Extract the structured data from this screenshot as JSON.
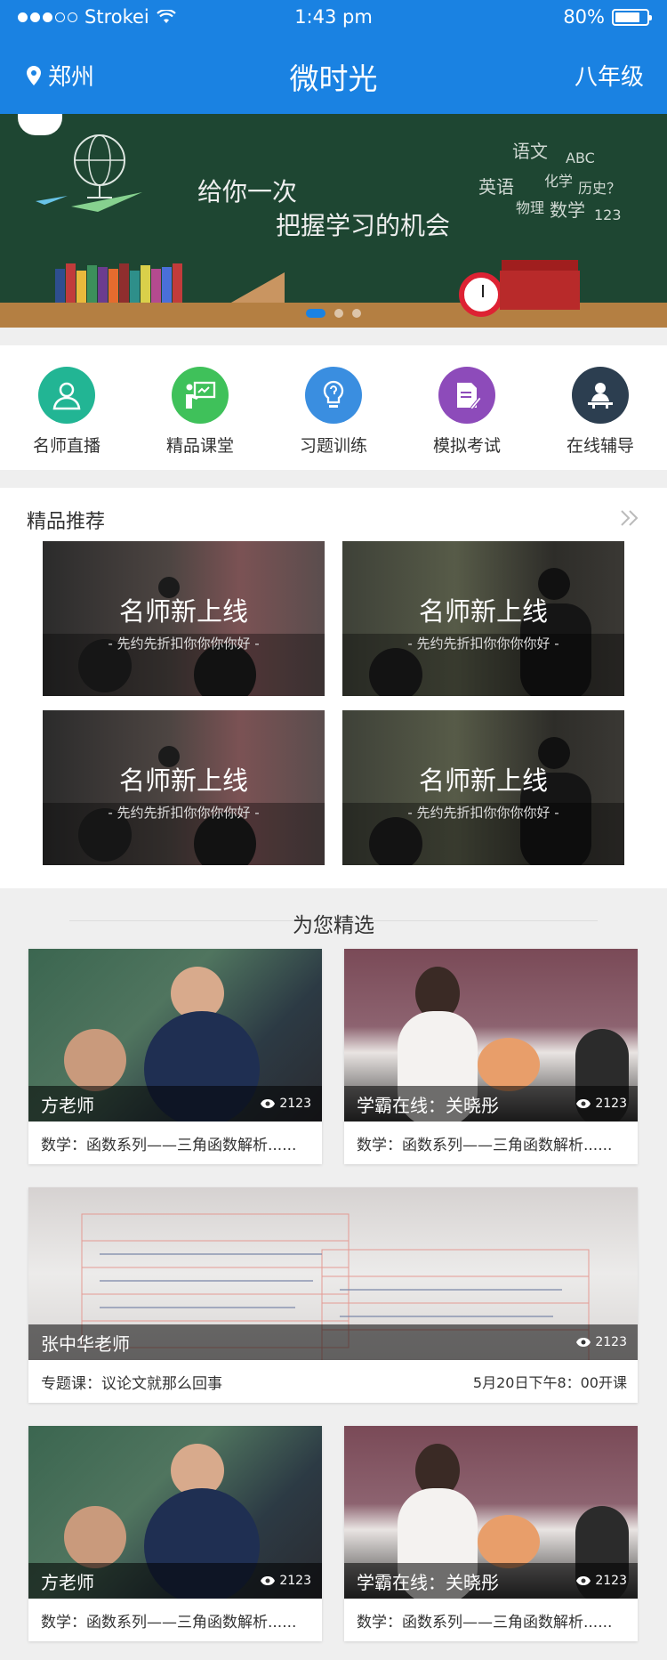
{
  "status_bar": {
    "carrier": "Strokei",
    "time": "1:43 pm",
    "battery": "80%",
    "battery_level": 0.8
  },
  "nav": {
    "location": "郑州",
    "title": "微时光",
    "grade": "八年级"
  },
  "banner": {
    "line1": "给你一次",
    "line2": "把握学习的机会",
    "chalk_words": [
      "语文",
      "英语",
      "数学",
      "化学",
      "物理",
      "历史？",
      "ABC",
      "123"
    ],
    "page_count": 3,
    "active_page": 1
  },
  "quick_menu": [
    {
      "label": "名师直播",
      "icon": "teacher-live-icon",
      "color": "#22b594"
    },
    {
      "label": "精品课堂",
      "icon": "classroom-board-icon",
      "color": "#3fc15a"
    },
    {
      "label": "习题训练",
      "icon": "lightbulb-icon",
      "color": "#3a8ee0"
    },
    {
      "label": "模拟考试",
      "icon": "exam-paper-icon",
      "color": "#8d4bba"
    },
    {
      "label": "在线辅导",
      "icon": "online-tutor-icon",
      "color": "#2c3e50"
    }
  ],
  "recommend": {
    "title": "精品推荐",
    "more_icon": "double-chevron-right-icon",
    "items": [
      {
        "title": "名师新上线",
        "subtitle": "- 先约先折扣你你你你好 -"
      },
      {
        "title": "名师新上线",
        "subtitle": "- 先约先折扣你你你你好 -"
      },
      {
        "title": "名师新上线",
        "subtitle": "- 先约先折扣你你你你好 -"
      },
      {
        "title": "名师新上线",
        "subtitle": "- 先约先折扣你你你你好 -"
      }
    ]
  },
  "selection": {
    "title": "为您精选",
    "cards": [
      {
        "name": "方老师",
        "views": "2123",
        "desc": "数学：函数系列——三角函数解析......"
      },
      {
        "name": "学霸在线：关晓彤",
        "views": "2123",
        "desc": "数学：函数系列——三角函数解析......"
      },
      {
        "name": "张中华老师",
        "views": "2123",
        "desc": "专题课：议论文就那么回事",
        "schedule": "5月20日下午8：00开课"
      },
      {
        "name": "方老师",
        "views": "2123",
        "desc": "数学：函数系列——三角函数解析......"
      },
      {
        "name": "学霸在线：关晓彤",
        "views": "2123",
        "desc": "数学：函数系列——三角函数解析......"
      }
    ]
  }
}
